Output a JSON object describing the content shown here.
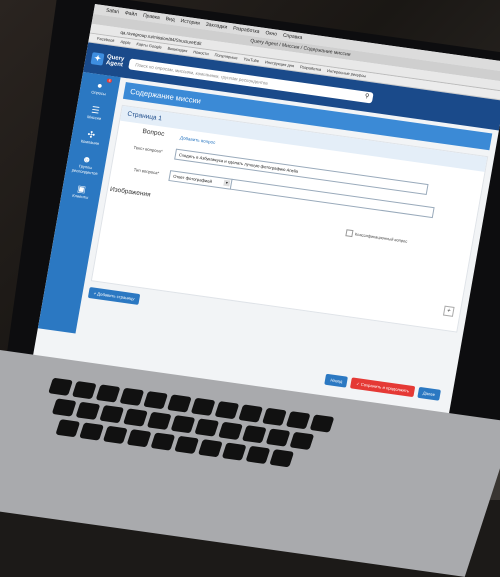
{
  "mac_menu": {
    "apple": "",
    "items": [
      "Safari",
      "Файл",
      "Правка",
      "Вид",
      "История",
      "Закладки",
      "Разработка",
      "Окно",
      "Справка"
    ]
  },
  "browser": {
    "window_title": "Query Agent / Миссии / Содержание миссии",
    "url": "qa.ravegroup.ru/mission/84/StructureEdit",
    "bookmarks": [
      "Facebook",
      "Apple",
      "Карты Google",
      "Википедия",
      "Новости",
      "Популярные",
      "YouTube",
      "Инструкция дня",
      "Разработка",
      "Интересные ресурсы"
    ]
  },
  "app": {
    "logo_line1": "Query",
    "logo_line2": "Agent",
    "search_placeholder": "Поиск по опросам, миссиям, компаниям, группам респондентов"
  },
  "sidebar": {
    "items": [
      {
        "label": "Опросы",
        "icon": "speech-bubble-icon",
        "badge": "6"
      },
      {
        "label": "Миссии",
        "icon": "list-icon"
      },
      {
        "label": "Компании",
        "icon": "puzzle-icon"
      },
      {
        "label": "Группы респондентов",
        "icon": "users-icon"
      },
      {
        "label": "Клиенты",
        "icon": "id-card-icon"
      }
    ]
  },
  "main": {
    "section_title": "Содержание миссии",
    "page_title": "Страница 1",
    "question_heading": "Вопрос",
    "add_question": "Добавить вопрос",
    "question_text_label": "Текст вопроса*",
    "question_text_value": "Сходить в Азбукавкуса и сделать лучшую фотографию Anelia",
    "question_type_label": "Тип вопроса*",
    "question_type_value": "Ответ фотографией",
    "images_heading": "Изображения",
    "classify_label": "Классификационный вопрос",
    "add_page": "+ Добавить страницу"
  },
  "footer": {
    "back": "Назад",
    "save_continue": "✓ Сохранить и продолжить",
    "next": "Далее"
  },
  "colors": {
    "header": "#1a4a8a",
    "sidebar": "#2b78c2",
    "accent_red": "#e53935"
  }
}
